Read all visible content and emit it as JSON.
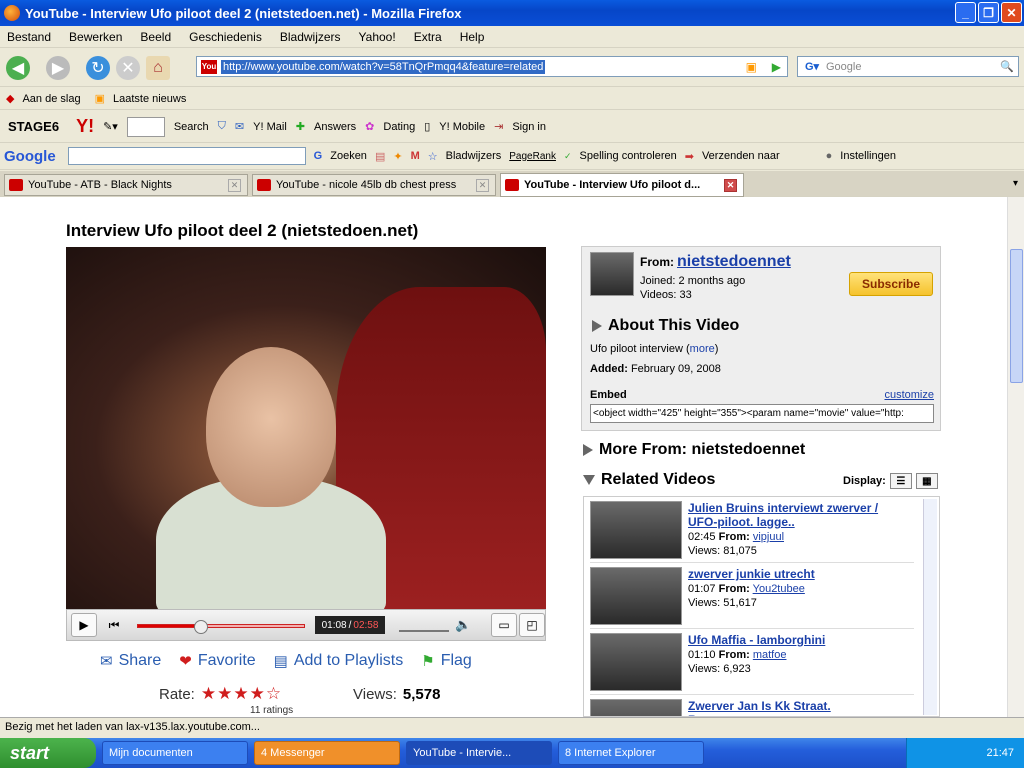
{
  "window": {
    "title": "YouTube - Interview Ufo piloot deel 2 (nietstedoen.net) - Mozilla Firefox"
  },
  "menu": [
    "Bestand",
    "Bewerken",
    "Beeld",
    "Geschiedenis",
    "Bladwijzers",
    "Yahoo!",
    "Extra",
    "Help"
  ],
  "nav": {
    "url": "http://www.youtube.com/watch?v=58TnQrPmqq4&feature=related",
    "search_placeholder": "Google"
  },
  "bookmarks": [
    "Aan de slag",
    "Laatste nieuws"
  ],
  "yahoo_toolbar": {
    "stage": "STAGE6",
    "yahoo": "Y!",
    "search": "Search",
    "mail": "Y! Mail",
    "answers": "Answers",
    "dating": "Dating",
    "mobile": "Y! Mobile",
    "signin": "Sign in"
  },
  "google_toolbar": {
    "logo": "Google",
    "zoeken": "Zoeken",
    "bladwijzers": "Bladwijzers",
    "pagerank": "PageRank",
    "spelling": "Spelling controleren",
    "verzenden": "Verzenden naar",
    "instellingen": "Instellingen"
  },
  "tabs": [
    {
      "label": "YouTube - ATB - Black Nights",
      "active": false
    },
    {
      "label": "YouTube - nicole 45lb db chest press",
      "active": false
    },
    {
      "label": "YouTube - Interview Ufo piloot d...",
      "active": true
    }
  ],
  "video": {
    "title": "Interview Ufo piloot deel 2 (nietstedoen.net)",
    "current_time": "01:08",
    "total_time": "02:58",
    "progress": 0.38,
    "actions": [
      "Share",
      "Favorite",
      "Add to Playlists",
      "Flag"
    ],
    "rate_label": "Rate:",
    "stars": "★★★★☆",
    "ratings": "11 ratings",
    "views_label": "Views:",
    "views": "5,578"
  },
  "channel": {
    "from_label": "From:",
    "name": "nietstedoennet",
    "joined": "Joined: 2 months ago",
    "videos": "Videos: 33",
    "subscribe": "Subscribe",
    "about_title": "About This Video",
    "description": "Ufo piloot interview",
    "more": "more",
    "added_label": "Added:",
    "added": "February 09, 2008",
    "embed_label": "Embed",
    "customize": "customize",
    "embed_code": "<object width=\"425\" height=\"355\"><param name=\"movie\" value=\"http:"
  },
  "more_from": "More From: nietstedoennet",
  "related_title": "Related Videos",
  "display_label": "Display:",
  "related": [
    {
      "title": "Julien Bruins interviewt zwerver / UFO-piloot. lagge..",
      "time": "02:45",
      "from": "vipjuul",
      "views": "Views: 81,075"
    },
    {
      "title": "zwerver junkie utrecht",
      "time": "01:07",
      "from": "You2tubee",
      "views": "Views: 51,617"
    },
    {
      "title": "Ufo Maffia - lamborghini",
      "time": "01:10",
      "from": "matfoe",
      "views": "Views: 6,923"
    },
    {
      "title": "Zwerver Jan Is Kk Straat. Represent",
      "time": "",
      "from": "",
      "views": ""
    }
  ],
  "status": "Bezig met het laden van lax-v135.lax.youtube.com...",
  "taskbar": {
    "start": "start",
    "tasks": [
      "Mijn documenten",
      "4 Messenger",
      "YouTube - Intervie...",
      "8 Internet Explorer"
    ],
    "clock": "21:47"
  }
}
